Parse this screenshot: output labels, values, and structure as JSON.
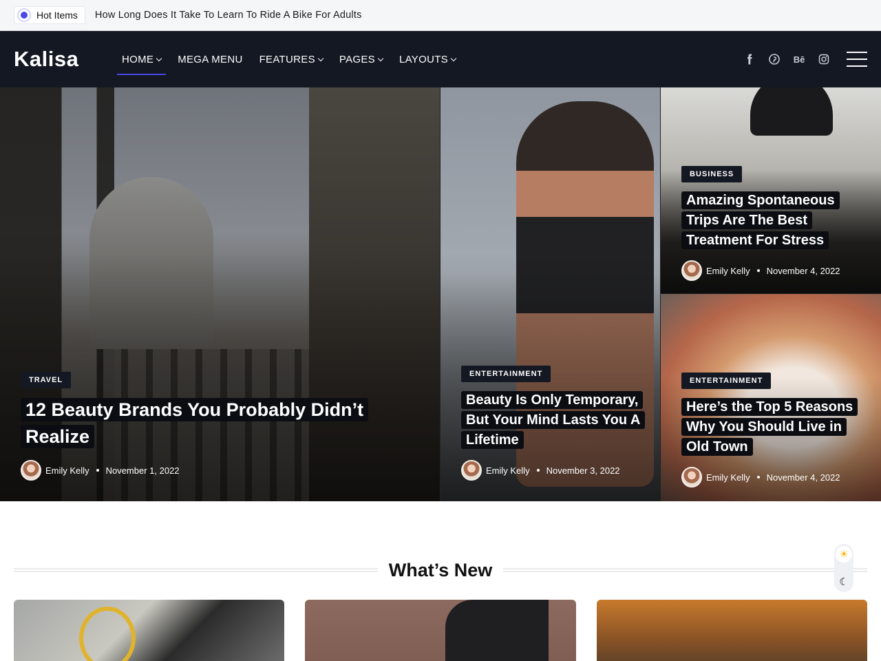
{
  "topbar": {
    "hot_label": "Hot Items",
    "headline": "How Long Does It Take To Learn To Ride A Bike For Adults"
  },
  "header": {
    "logo": "Kalisa",
    "nav": [
      {
        "label": "HOME",
        "has_dropdown": true,
        "active": true
      },
      {
        "label": "MEGA MENU",
        "has_dropdown": false,
        "active": false
      },
      {
        "label": "FEATURES",
        "has_dropdown": true,
        "active": false
      },
      {
        "label": "PAGES",
        "has_dropdown": true,
        "active": false
      },
      {
        "label": "LAYOUTS",
        "has_dropdown": true,
        "active": false
      }
    ],
    "socials": [
      "facebook-icon",
      "pinterest-icon",
      "behance-icon",
      "instagram-icon"
    ],
    "accent_color": "#4b49e8"
  },
  "hero": {
    "posts": [
      {
        "category": "TRAVEL",
        "title": "12 Beauty Brands You Probably Didn’t Realize",
        "author": "Emily Kelly",
        "date": "November 1, 2022"
      },
      {
        "category": "ENTERTAINMENT",
        "title": "Beauty Is Only Temporary, But Your Mind Lasts You A Lifetime",
        "author": "Emily Kelly",
        "date": "November 3, 2022"
      },
      {
        "category": "BUSINESS",
        "title": "Amazing Spontaneous Trips Are The Best Treatment For Stress",
        "author": "Emily Kelly",
        "date": "November 4, 2022"
      },
      {
        "category": "ENTERTAINMENT",
        "title": "Here’s the Top 5 Reasons Why You Should Live in Old Town",
        "author": "Emily Kelly",
        "date": "November 4, 2022"
      }
    ]
  },
  "section": {
    "title": "What’s New"
  },
  "theme_toggle": {
    "light_icon": "sun-icon",
    "dark_icon": "moon-icon"
  }
}
